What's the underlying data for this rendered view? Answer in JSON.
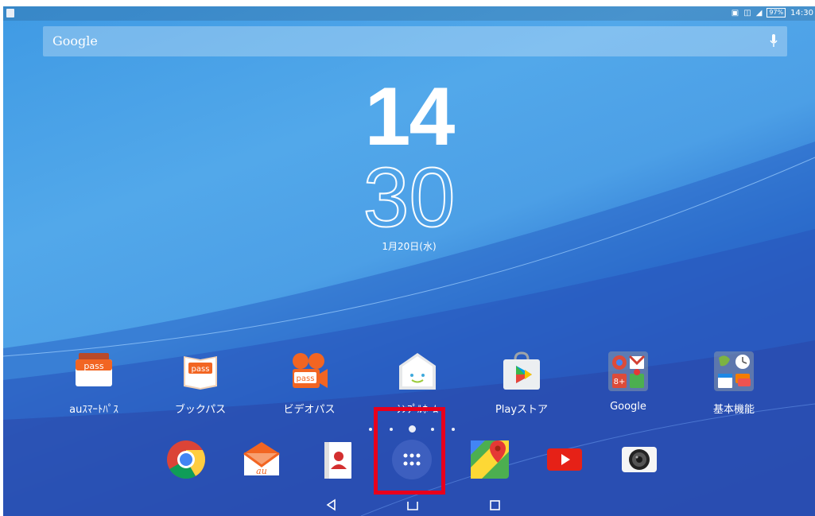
{
  "status_bar": {
    "battery": "97%",
    "time": "14:30"
  },
  "search": {
    "label": "Google"
  },
  "clock": {
    "hour": "14",
    "minute": "30",
    "date": "1月20日(水)"
  },
  "home_apps": [
    {
      "label": "auｽﾏｰﾄﾊﾟｽ",
      "icon": "au-smart-pass-icon"
    },
    {
      "label": "ブックパス",
      "icon": "book-pass-icon"
    },
    {
      "label": "ビデオパス",
      "icon": "video-pass-icon"
    },
    {
      "label": "ｼﾝﾌﾟﾙﾎｰﾑ",
      "icon": "simple-home-icon"
    },
    {
      "label": "Playストア",
      "icon": "play-store-icon"
    },
    {
      "label": "Google",
      "icon": "google-folder-icon"
    },
    {
      "label": "基本機能",
      "icon": "basic-functions-folder-icon"
    }
  ],
  "icon_text": {
    "pass": "pass",
    "au": "au",
    "gplus": "8+"
  },
  "dock": [
    "chrome-icon",
    "au-mail-icon",
    "contacts-icon",
    "app-drawer-icon",
    "maps-icon",
    "youtube-icon",
    "camera-icon"
  ],
  "colors": {
    "highlight": "#e8001c",
    "pass_orange": "#f26522"
  }
}
